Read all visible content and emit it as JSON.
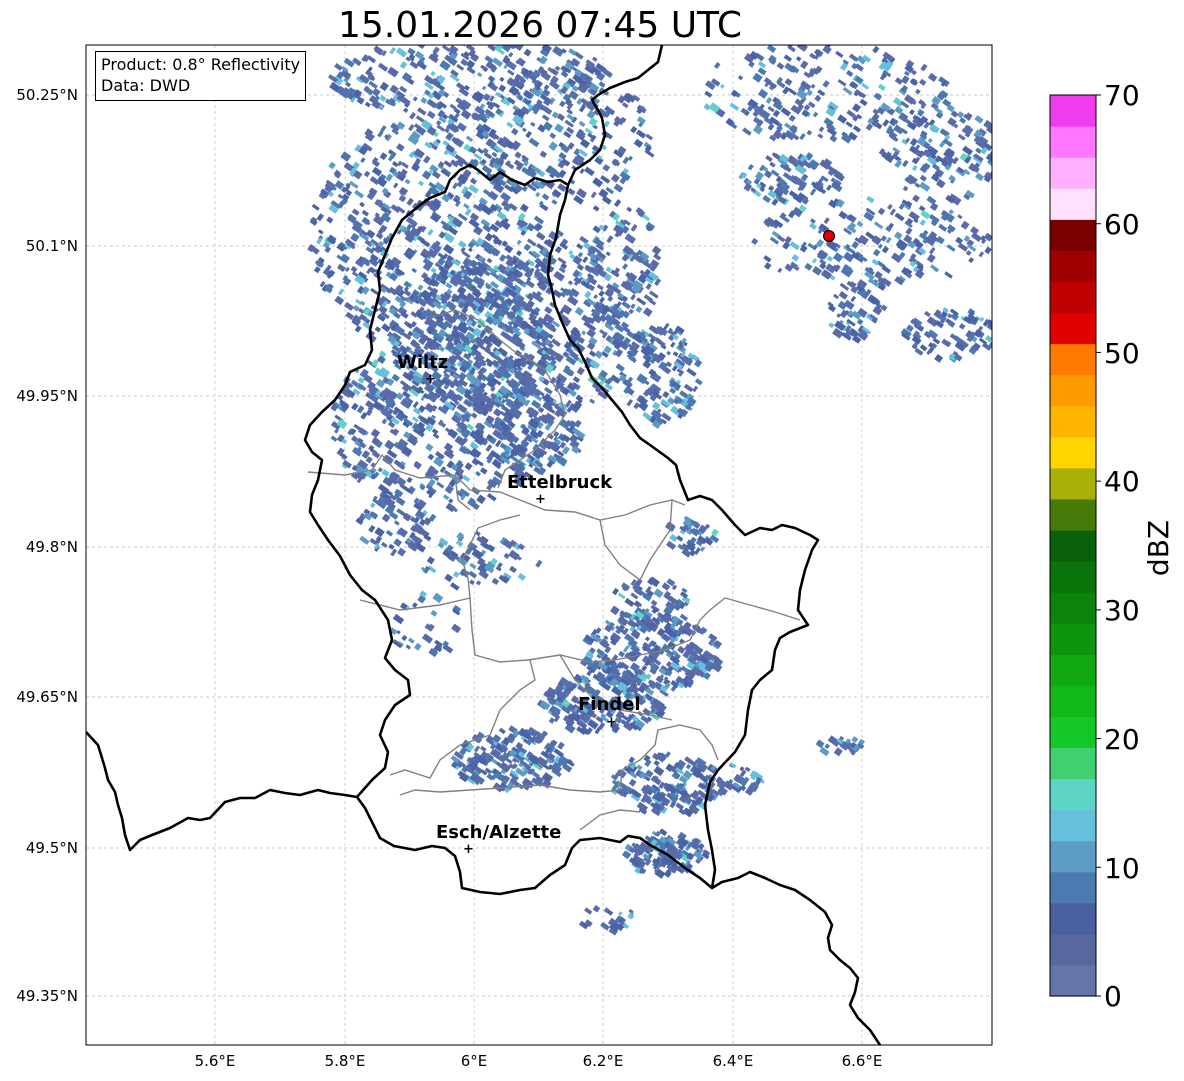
{
  "title": "15.01.2026 07:45 UTC",
  "info": {
    "product": "Product: 0.8° Reflectivity",
    "data": "Data: DWD"
  },
  "axes": {
    "lat_ticks": [
      "50.25°N",
      "50.1°N",
      "49.95°N",
      "49.8°N",
      "49.65°N",
      "49.5°N",
      "49.35°N"
    ],
    "lon_ticks": [
      "5.6°E",
      "5.8°E",
      "6°E",
      "6.2°E",
      "6.4°E",
      "6.6°E"
    ]
  },
  "colorbar": {
    "label": "dBZ",
    "tick_labels": [
      "0",
      "10",
      "20",
      "30",
      "40",
      "50",
      "60",
      "70"
    ],
    "colors": [
      "#6675a8",
      "#56689e",
      "#4a5fa0",
      "#4a7ab0",
      "#5c9cc4",
      "#66c0dc",
      "#5ed4c4",
      "#40d070",
      "#14c828",
      "#10b818",
      "#12a812",
      "#0e940e",
      "#0c840c",
      "#0a740a",
      "#0a600a",
      "#467a0a",
      "#aab00a",
      "#ffd400",
      "#fdb500",
      "#fe9b00",
      "#ff7a00",
      "#e10000",
      "#c00000",
      "#a00000",
      "#7a0000",
      "#ffe0ff",
      "#ffb0ff",
      "#ff78ff",
      "#ee3cee"
    ]
  },
  "cities": [
    {
      "name": "Wiltz"
    },
    {
      "name": "Ettelbruck"
    },
    {
      "name": "Findel"
    },
    {
      "name": "Esch/Alzette"
    }
  ],
  "colors": {
    "border": "#000000",
    "district": "#808080",
    "grid": "#bbbbbb",
    "radar_site": "#e00000"
  }
}
